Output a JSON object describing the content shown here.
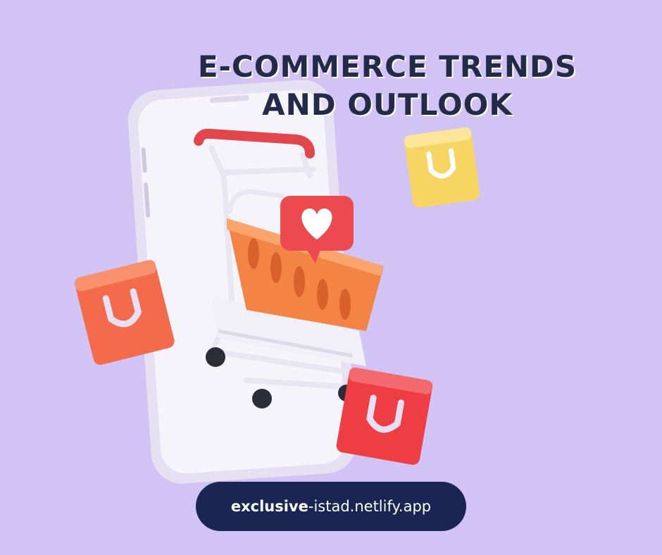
{
  "title": {
    "line1": "E-COMMERCE TRENDS",
    "line2": "AND OUTLOOK"
  },
  "link": {
    "bold_part": "exclusive",
    "rest": "-istad.netlify.app"
  },
  "colors": {
    "background": "#d1c3f4",
    "title_text": "#232a4a",
    "pill": "#1b2553",
    "cart_handle": "#e2454a",
    "basket": "#f38446",
    "heart_badge": "#ec4a4f",
    "bag_yellow": "#f6d563",
    "bag_orange": "#f46b4c",
    "bag_red": "#ee3e44"
  },
  "icons": [
    "phone-icon",
    "shopping-cart-icon",
    "heart-icon",
    "shopping-bag-icon"
  ]
}
